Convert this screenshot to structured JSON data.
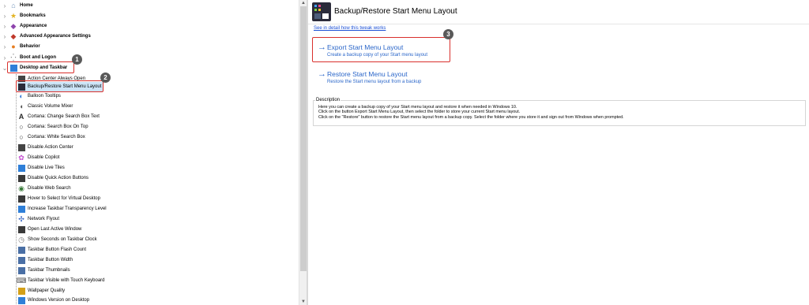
{
  "tree": {
    "top_items": [
      {
        "label": "Home",
        "icon": "home-icon",
        "color": "#6d8fb8"
      },
      {
        "label": "Bookmarks",
        "icon": "star-icon",
        "color": "#e3b322"
      },
      {
        "label": "Appearance",
        "icon": "appearance-icon",
        "color": "#8e44ad"
      },
      {
        "label": "Advanced Appearance Settings",
        "icon": "advanced-appearance-icon",
        "color": "#c0392b"
      },
      {
        "label": "Behavior",
        "icon": "behavior-icon",
        "color": "#e67e22"
      },
      {
        "label": "Boot and Logon",
        "icon": "boot-icon",
        "color": "#555555"
      },
      {
        "label": "Desktop and Taskbar",
        "icon": "desktop-taskbar-icon",
        "color": "#2f7fd8"
      }
    ],
    "children": [
      {
        "label": "Action Center Always Open",
        "icon": "action-center-icon",
        "color": "#444444"
      },
      {
        "label": "Backup/Restore Start Menu Layout",
        "icon": "start-menu-icon",
        "color": "#2b2b3a"
      },
      {
        "label": "Balloon Tooltips",
        "icon": "balloon-icon",
        "color": "#3b7dd8"
      },
      {
        "label": "Classic Volume Mixer",
        "icon": "volume-icon",
        "color": "#555555"
      },
      {
        "label": "Cortana: Change Search Box Text",
        "icon": "text-icon",
        "color": "#2b2b2b"
      },
      {
        "label": "Cortana: Search Box On Top",
        "icon": "cortana-icon",
        "color": "#333333"
      },
      {
        "label": "Cortana: White Search Box",
        "icon": "cortana-icon",
        "color": "#333333"
      },
      {
        "label": "Disable Action Center",
        "icon": "action-center-icon",
        "color": "#444444"
      },
      {
        "label": "Disable Copilot",
        "icon": "copilot-icon",
        "color": "#c44fd0"
      },
      {
        "label": "Disable Live Tiles",
        "icon": "tiles-icon",
        "color": "#2f7fd8"
      },
      {
        "label": "Disable Quick Action Buttons",
        "icon": "quick-action-icon",
        "color": "#3a3a3a"
      },
      {
        "label": "Disable Web Search",
        "icon": "web-search-icon",
        "color": "#3a7b3a"
      },
      {
        "label": "Hover to Select for Virtual Desktop",
        "icon": "virtual-desktop-icon",
        "color": "#3a3a3a"
      },
      {
        "label": "Increase Taskbar Transparency Level",
        "icon": "taskbar-icon",
        "color": "#2f7fd8"
      },
      {
        "label": "Network Flyout",
        "icon": "network-icon",
        "color": "#2f5fbf"
      },
      {
        "label": "Open Last Active Window",
        "icon": "window-icon",
        "color": "#3a3a3a"
      },
      {
        "label": "Show Seconds on Taskbar Clock",
        "icon": "clock-icon",
        "color": "#777777"
      },
      {
        "label": "Taskbar Button Flash Count",
        "icon": "taskbar-icon",
        "color": "#4a6fa5"
      },
      {
        "label": "Taskbar Button Width",
        "icon": "taskbar-icon",
        "color": "#4a6fa5"
      },
      {
        "label": "Taskbar Thumbnails",
        "icon": "thumbnails-icon",
        "color": "#4a6fa5"
      },
      {
        "label": "Taskbar Visible with Touch Keyboard",
        "icon": "keyboard-icon",
        "color": "#555555"
      },
      {
        "label": "Wallpaper Quality",
        "icon": "wallpaper-icon",
        "color": "#d4a017"
      },
      {
        "label": "Windows Version on Desktop",
        "icon": "windows-version-icon",
        "color": "#2f7fd8"
      }
    ]
  },
  "badges": [
    "1",
    "2",
    "3"
  ],
  "header": {
    "title": "Backup/Restore Start Menu Layout"
  },
  "link_text": "See in detail how this tweak works",
  "actions": {
    "export": {
      "title": "Export Start Menu Layout",
      "subtitle": "Create a backup copy of your Start menu layout"
    },
    "restore": {
      "title": "Restore Start Menu Layout",
      "subtitle": "Restore the Start menu layout from a backup"
    }
  },
  "description": {
    "legend": "Description",
    "lines": [
      "Here you can create a backup copy of your Start menu layout and restore it when needed in Windows 10.",
      "Click on the button Export Start Menu Layout, then select the folder to store your current Start menu layout.",
      "Click on the \"Restore\" button to restore the Start menu layout from a backup copy. Select the folder where you store it and sign out from Windows when prompted."
    ]
  },
  "colors": {
    "accent": "#2a66c9",
    "highlight": "#d9302c",
    "badge": "#595959",
    "selection": "#cce4f7"
  }
}
